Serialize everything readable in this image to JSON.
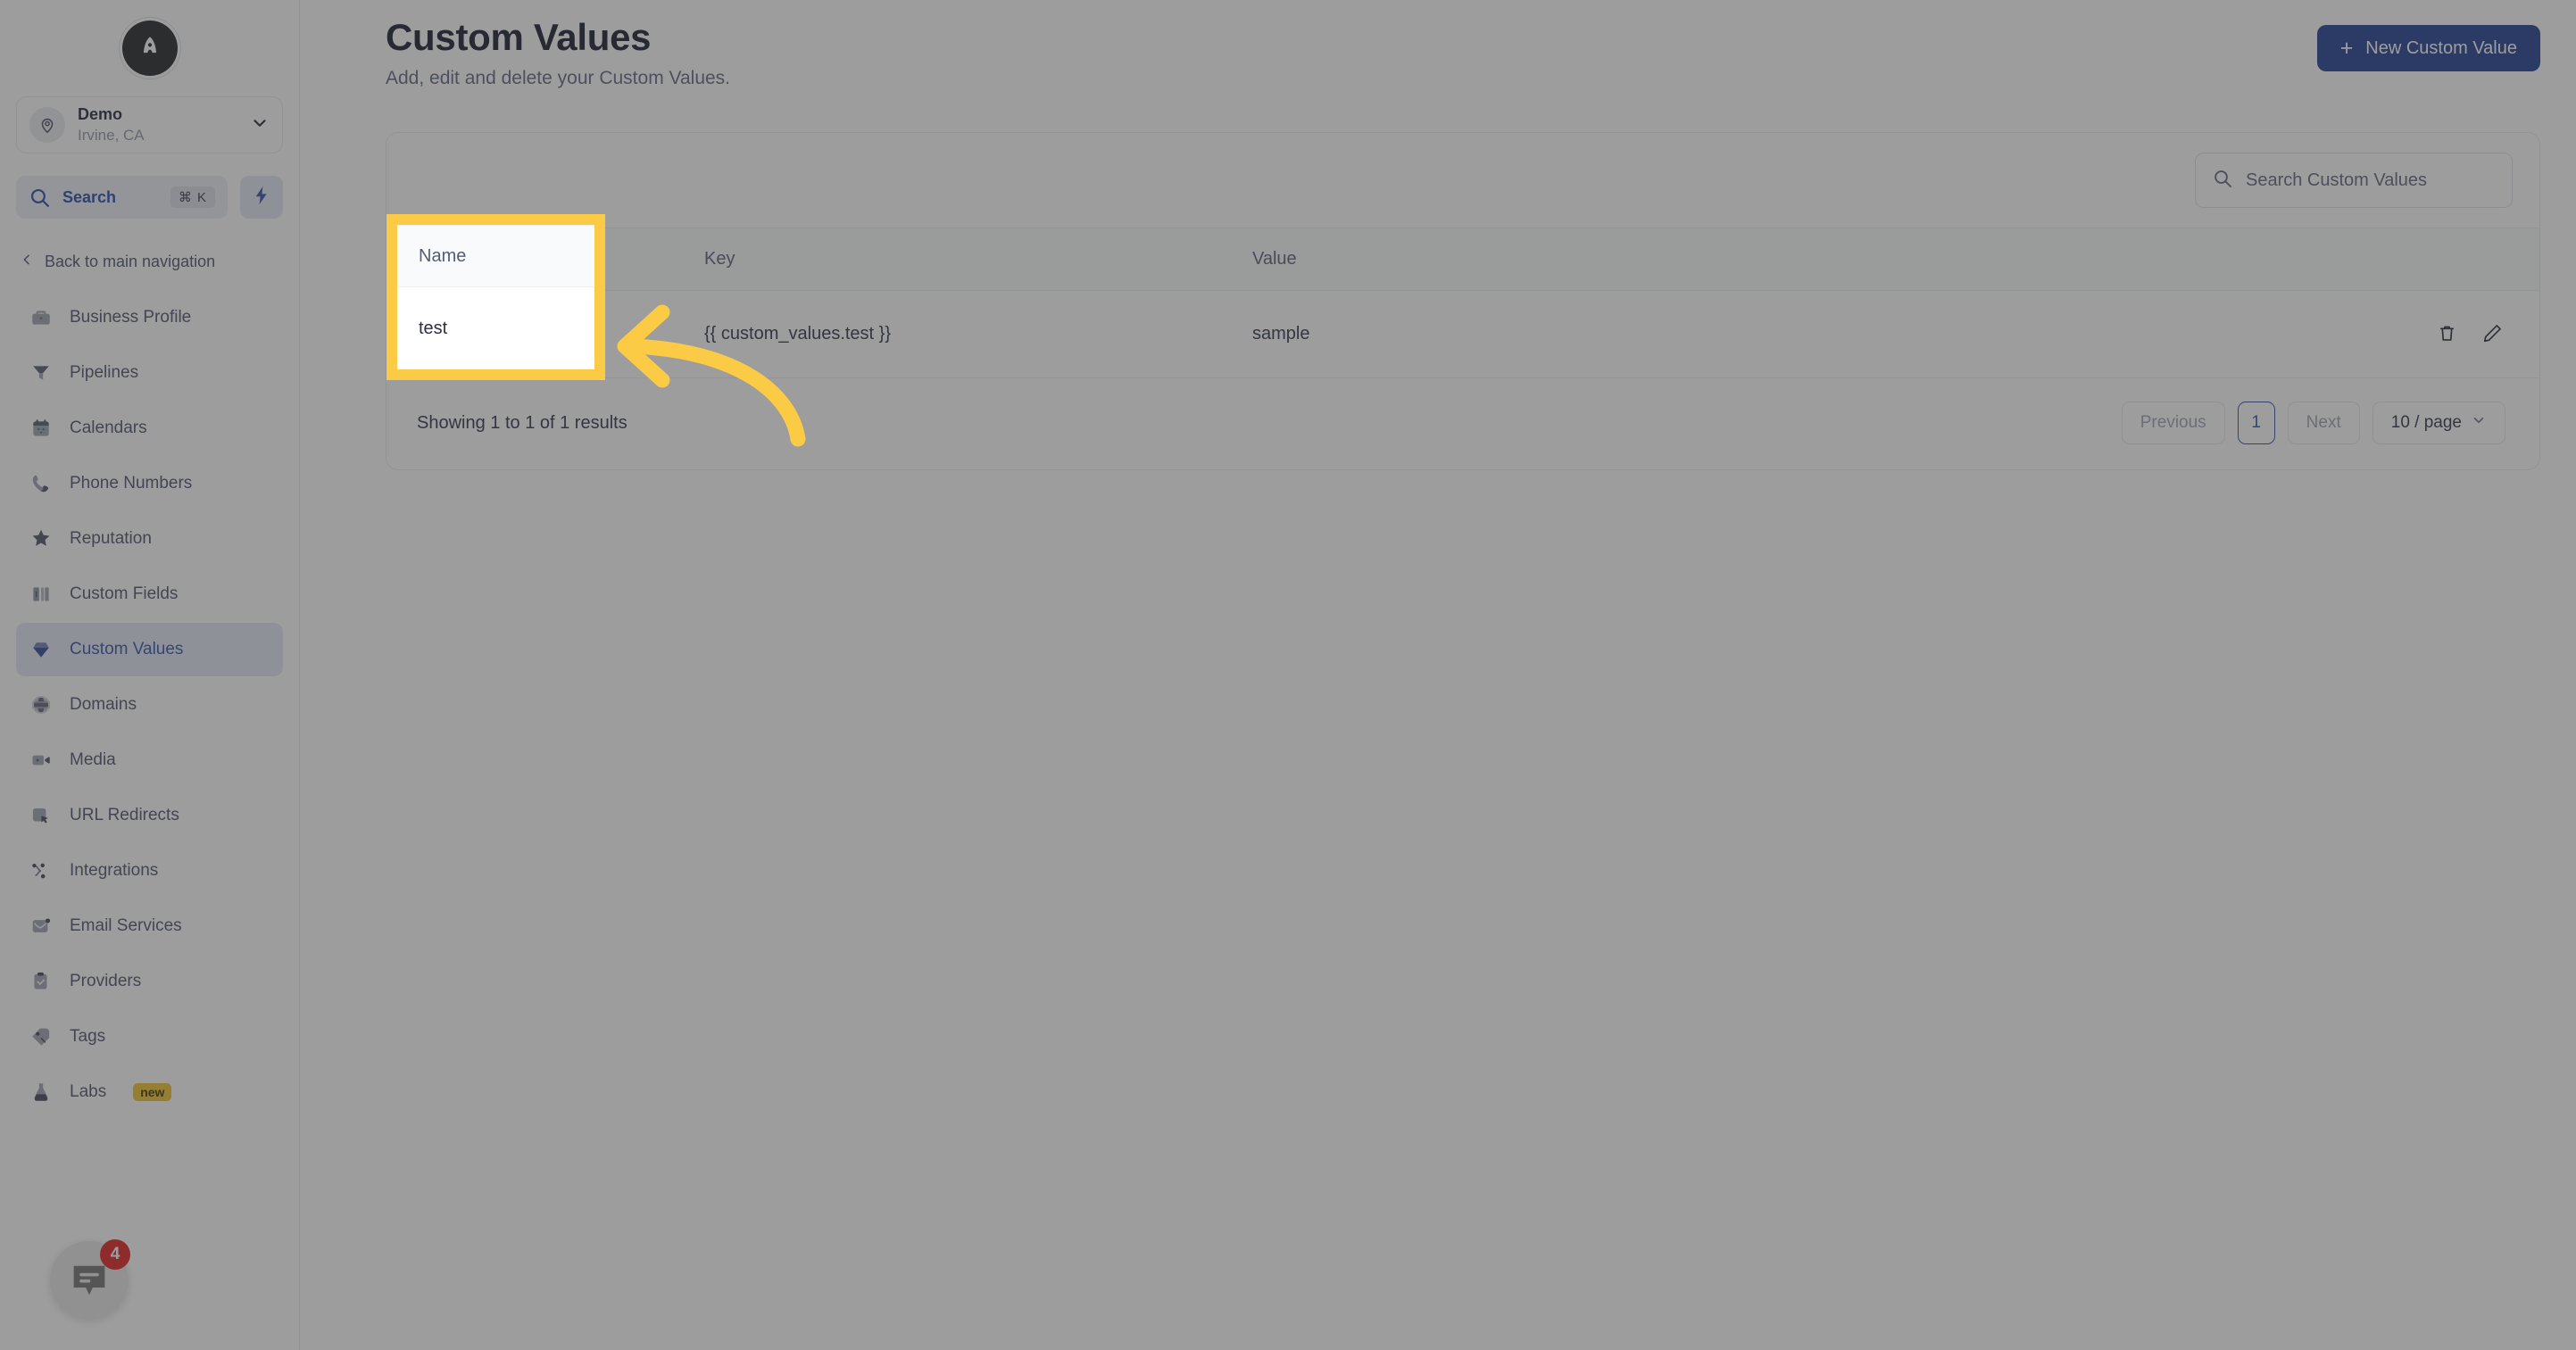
{
  "brand": {
    "logo_icon": "rocket-logo-icon",
    "accent": "#1d3a8f",
    "highlight": "#fbcb46"
  },
  "sidebar": {
    "location": {
      "name": "Demo",
      "sub": "Irvine, CA",
      "avatar_icon": "location-pin-icon",
      "chevron_icon": "chevron-down-icon"
    },
    "search": {
      "label": "Search",
      "shortcut": "⌘ K",
      "icon": "search-icon",
      "quick_action_icon": "lightning-bolt-icon"
    },
    "back": {
      "label": "Back to main navigation",
      "icon": "chevron-left-icon"
    },
    "items": [
      {
        "label": "Business Profile",
        "icon": "briefcase-icon",
        "active": false
      },
      {
        "label": "Pipelines",
        "icon": "funnel-icon",
        "active": false
      },
      {
        "label": "Calendars",
        "icon": "calendar-icon",
        "active": false
      },
      {
        "label": "Phone Numbers",
        "icon": "phone-icon",
        "active": false
      },
      {
        "label": "Reputation",
        "icon": "star-icon",
        "active": false
      },
      {
        "label": "Custom Fields",
        "icon": "columns-icon",
        "active": false
      },
      {
        "label": "Custom Values",
        "icon": "gem-icon",
        "active": true
      },
      {
        "label": "Domains",
        "icon": "globe-icon",
        "active": false
      },
      {
        "label": "Media",
        "icon": "video-icon",
        "active": false
      },
      {
        "label": "URL Redirects",
        "icon": "cursor-icon",
        "active": false
      },
      {
        "label": "Integrations",
        "icon": "nodes-icon",
        "active": false
      },
      {
        "label": "Email Services",
        "icon": "envelope-icon",
        "active": false
      },
      {
        "label": "Providers",
        "icon": "clipboard-check-icon",
        "active": false
      },
      {
        "label": "Tags",
        "icon": "tag-icon",
        "active": false
      },
      {
        "label": "Labs",
        "icon": "flask-icon",
        "active": false,
        "badge": "new"
      }
    ]
  },
  "header": {
    "title": "Custom Values",
    "subtitle": "Add, edit and delete your Custom Values.",
    "new_button": {
      "label": "New Custom Value",
      "icon": "plus-icon"
    }
  },
  "table": {
    "search": {
      "placeholder": "Search Custom Values",
      "value": "",
      "icon": "search-icon"
    },
    "columns": [
      "Name",
      "Key",
      "Value",
      ""
    ],
    "rows": [
      {
        "name": "test",
        "key": "{{ custom_values.test }}",
        "value": "sample",
        "actions": [
          {
            "name": "delete-row-button",
            "icon": "trash-icon"
          },
          {
            "name": "edit-row-button",
            "icon": "pencil-icon"
          }
        ]
      }
    ],
    "footer": {
      "showing": "Showing 1 to 1 of 1 results",
      "previous": "Previous",
      "next": "Next",
      "current_page": "1",
      "page_size": "10 / page",
      "page_size_chevron": "chevron-down-icon"
    }
  },
  "annotation": {
    "highlight_target": "name-column",
    "highlight_color": "#fbcb46",
    "arrow_icon": "curved-arrow-left-icon",
    "spotlight_header": "Name",
    "spotlight_cell": "test"
  },
  "chat_widget": {
    "count": "4",
    "icon": "chat-bubble-icon"
  }
}
